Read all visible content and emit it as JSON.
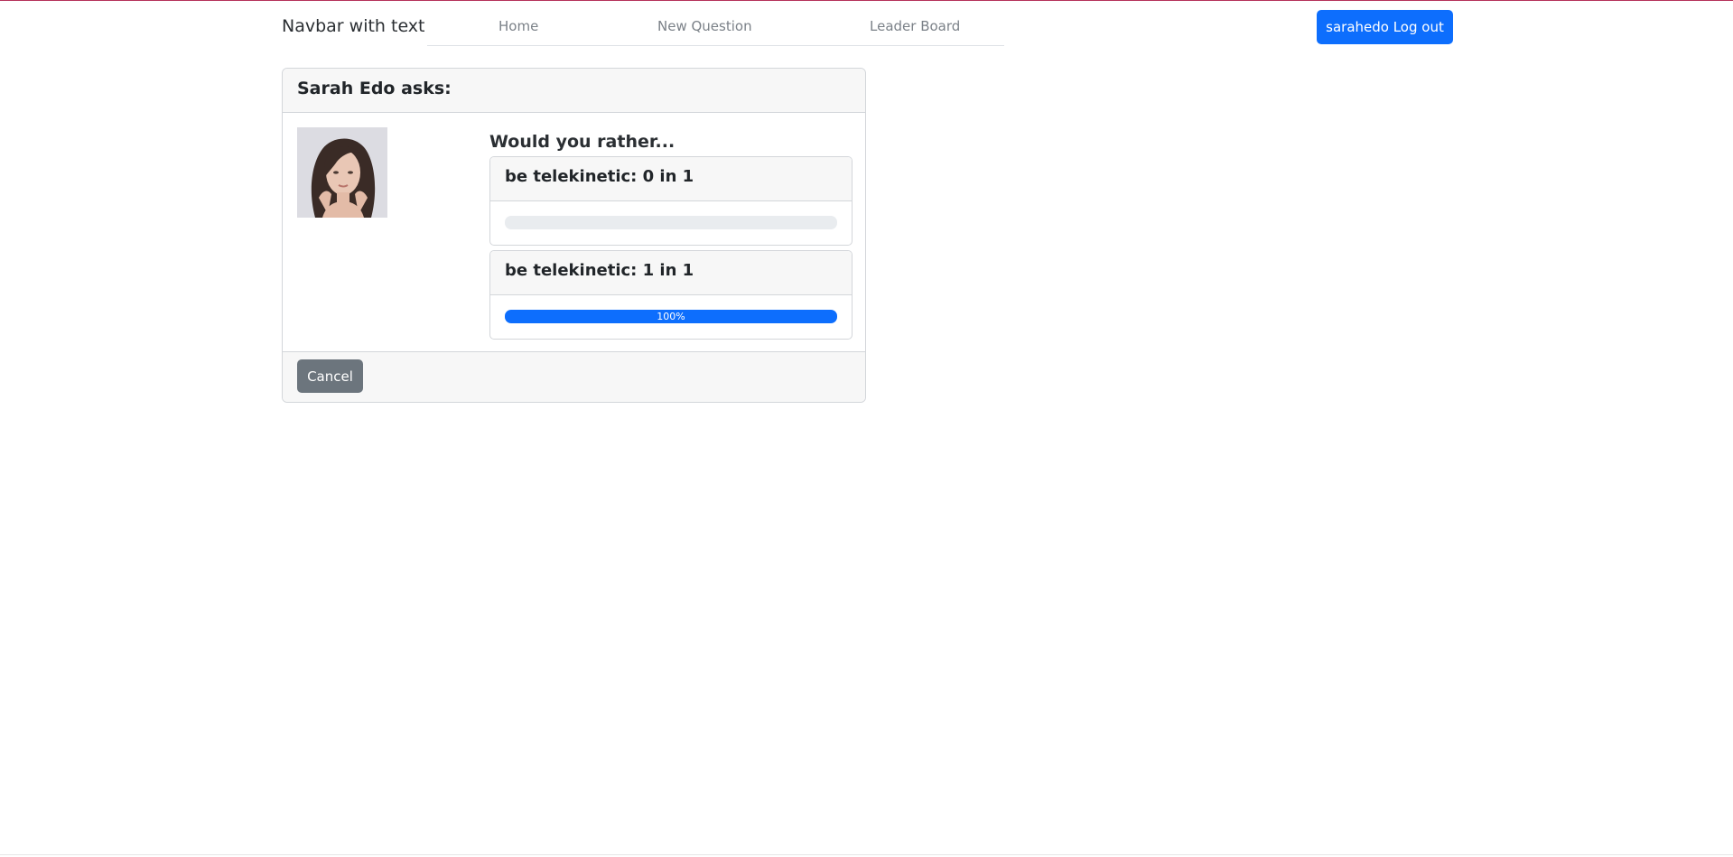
{
  "navbar": {
    "brand": "Navbar with text",
    "links": [
      {
        "label": "Home"
      },
      {
        "label": "New Question"
      },
      {
        "label": "Leader Board"
      }
    ],
    "logout_label": "sarahedo Log out"
  },
  "question": {
    "header": "Sarah Edo asks:",
    "prompt": "Would you rather...",
    "avatar_icon": "woman-portrait-avatar",
    "options": [
      {
        "label": "be telekinetic: 0 in 1",
        "progress_percent": 0,
        "progress_text": ""
      },
      {
        "label": "be telekinetic: 1 in 1",
        "progress_percent": 100,
        "progress_text": "100%"
      }
    ],
    "cancel_label": "Cancel"
  },
  "colors": {
    "primary": "#0d6efd",
    "secondary": "#6c757d",
    "top_border": "#b5325a"
  }
}
